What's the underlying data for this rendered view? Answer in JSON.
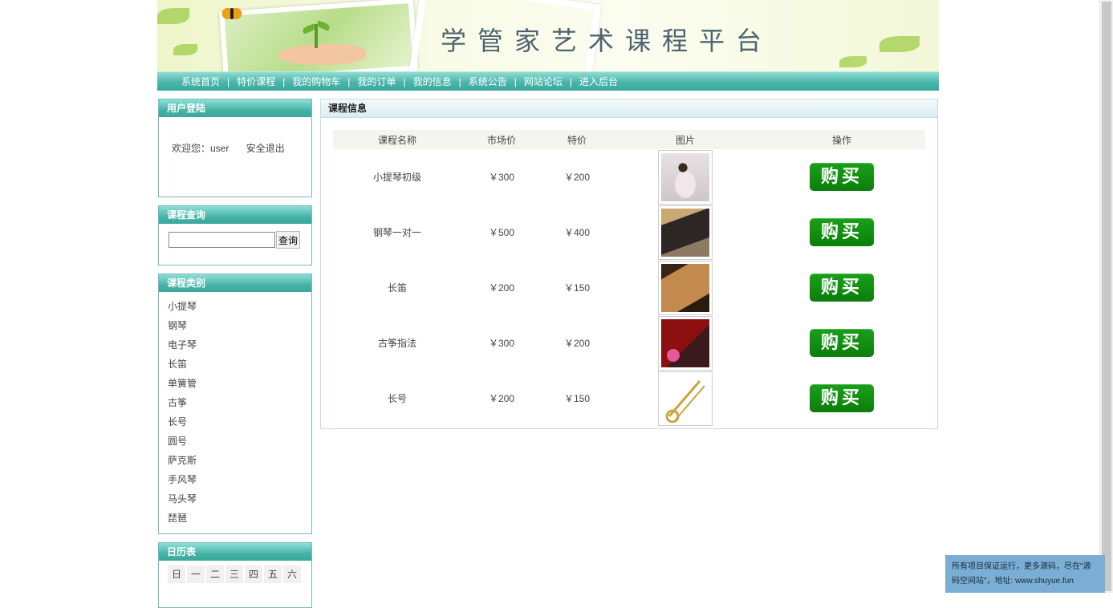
{
  "site": {
    "title": "学管家艺术课程平台"
  },
  "nav": {
    "items": [
      "系统首页",
      "特价课程",
      "我的购物车",
      "我的订单",
      "我的信息",
      "系统公告",
      "网站论坛",
      "进入后台"
    ]
  },
  "login": {
    "title": "用户登陆",
    "welcome": "欢迎您：user",
    "logout": "安全退出"
  },
  "query": {
    "title": "课程查询",
    "input_value": "",
    "button": "查询"
  },
  "categories": {
    "title": "课程类别",
    "items": [
      "小提琴",
      "钢琴",
      "电子琴",
      "长笛",
      "单簧管",
      "古筝",
      "长号",
      "圆号",
      "萨克斯",
      "手风琴",
      "马头琴",
      "琵琶"
    ]
  },
  "calendar": {
    "title": "日历表",
    "weekdays": [
      "日",
      "一",
      "二",
      "三",
      "四",
      "五",
      "六"
    ]
  },
  "main": {
    "title": "课程信息",
    "columns": [
      "课程名称",
      "市场价",
      "特价",
      "图片",
      "操作"
    ],
    "rows": [
      {
        "name": "小提琴初级",
        "market_price": "￥300",
        "special_price": "￥200",
        "image": "violin-photo",
        "action": "购买"
      },
      {
        "name": "钢琴一对一",
        "market_price": "￥500",
        "special_price": "￥400",
        "image": "piano-photo",
        "action": "购买"
      },
      {
        "name": "长笛",
        "market_price": "￥200",
        "special_price": "￥150",
        "image": "flute-photo",
        "action": "购买"
      },
      {
        "name": "古筝指法",
        "market_price": "￥300",
        "special_price": "￥200",
        "image": "guzheng-photo",
        "action": "购买"
      },
      {
        "name": "长号",
        "market_price": "￥200",
        "special_price": "￥150",
        "image": "trombone-photo",
        "action": "购买"
      }
    ]
  },
  "notice": {
    "text": "所有项目保证运行，更多源码，尽在\"源码空间站\"，地址: www.shuyue.fun"
  },
  "colors": {
    "nav_teal": "#4bb5aa",
    "buy_green": "#0b7e0b",
    "box_border": "#79b8c6",
    "notice_blue": "#7aaed4"
  }
}
